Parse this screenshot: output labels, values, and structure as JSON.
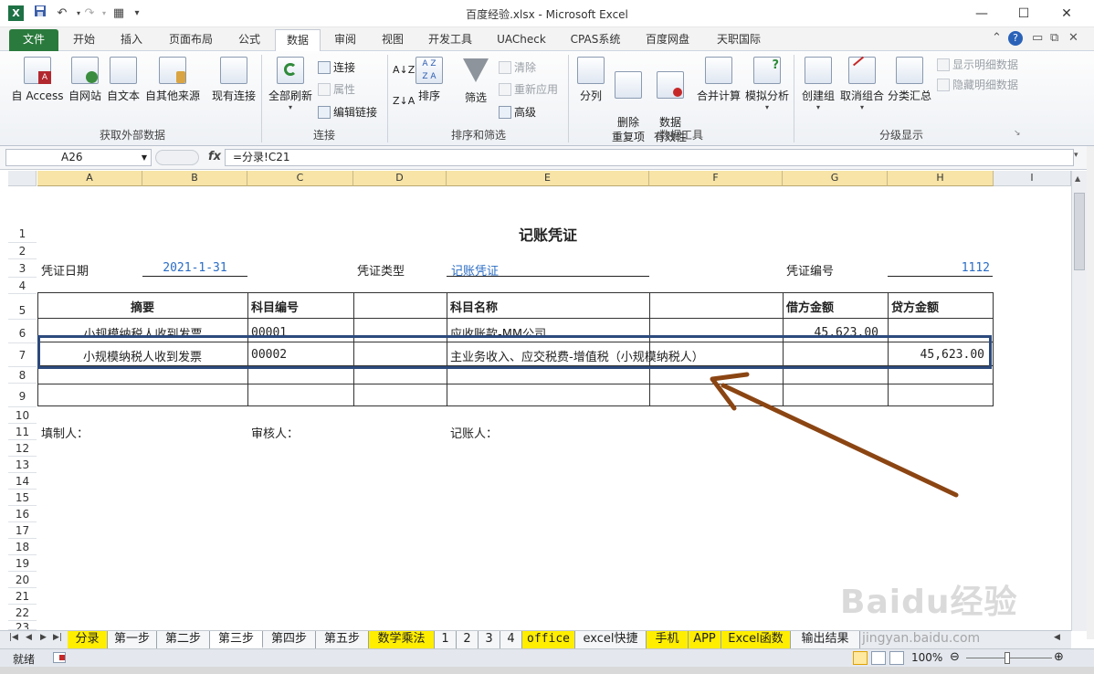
{
  "window": {
    "title": "百度经验.xlsx - Microsoft Excel",
    "minimize": "—",
    "maximize": "☐",
    "close": "✕"
  },
  "quick_access": {
    "logo": "X",
    "save_icon": "save-icon",
    "undo_icon": "undo-icon",
    "redo_icon": "redo-icon"
  },
  "ribbon_tabs": [
    "文件",
    "开始",
    "插入",
    "页面布局",
    "公式",
    "数据",
    "审阅",
    "视图",
    "开发工具",
    "UACheck",
    "CPAS系统",
    "百度网盘",
    "天职国际"
  ],
  "active_tab": "数据",
  "groups": {
    "external": {
      "label": "获取外部数据",
      "buttons": [
        "自 Access",
        "自网站",
        "自文本",
        "自其他来源",
        "现有连接"
      ]
    },
    "connections": {
      "label": "连接",
      "refresh": "全部刷新",
      "items": [
        "连接",
        "属性",
        "编辑链接"
      ]
    },
    "sort": {
      "label": "排序和筛选",
      "sort": "排序",
      "filter": "筛选",
      "items": [
        "清除",
        "重新应用",
        "高级"
      ]
    },
    "tools": {
      "label": "数据工具",
      "buttons": [
        "分列",
        "删除\n重复项",
        "数据\n有效性",
        "合并计算",
        "模拟分析"
      ]
    },
    "outline": {
      "label": "分级显示",
      "buttons": [
        "创建组",
        "取消组合",
        "分类汇总"
      ],
      "items": [
        "显示明细数据",
        "隐藏明细数据"
      ]
    }
  },
  "formula_bar": {
    "name_box": "A26",
    "fx": "fx",
    "formula": "=分录!C21"
  },
  "columns": [
    "A",
    "B",
    "C",
    "D",
    "E",
    "F",
    "G",
    "H",
    "I"
  ],
  "rows": [
    "1",
    "2",
    "3",
    "4",
    "5",
    "6",
    "7",
    "8",
    "9",
    "10",
    "11",
    "12",
    "13",
    "14",
    "15",
    "16",
    "17",
    "18",
    "19",
    "20",
    "21",
    "22",
    "23"
  ],
  "voucher": {
    "title": "记账凭证",
    "date_label": "凭证日期",
    "date_value": "2021-1-31",
    "type_label": "凭证类型",
    "type_value": "记账凭证",
    "number_label": "凭证编号",
    "number_value": "1112",
    "headers": {
      "summary": "摘要",
      "account_code": "科目编号",
      "account_name": "科目名称",
      "debit": "借方金额",
      "credit": "贷方金额"
    },
    "lines": [
      {
        "summary": "小规模纳税人收到发票",
        "code": "00001",
        "name": "应收账款-MM公司",
        "debit": "45,623.00",
        "credit": ""
      },
      {
        "summary": "小规模纳税人收到发票",
        "code": "00002",
        "name": "主业务收入、应交税费-增值税（小规模纳税人）",
        "debit": "",
        "credit": "45,623.00"
      }
    ],
    "preparer": "填制人：",
    "reviewer": "审核人：",
    "bookkeeper": "记账人："
  },
  "sheet_tabs": [
    "分录",
    "第一步",
    "第二步",
    "第三步",
    "第四步",
    "第五步",
    "数学乘法",
    "1",
    "2",
    "3",
    "4",
    "office",
    "excel快捷",
    "手机",
    "APP",
    "Excel函数",
    "输出结果"
  ],
  "active_sheet": "第三步",
  "status": {
    "ready": "就绪",
    "zoom": "100%"
  },
  "watermark": "Baidu经验",
  "watermark_url": "jingyan.baidu.com",
  "colors": {
    "excel_green": "#2b7a3d",
    "highlight_border": "#2c4a7c",
    "arrow": "#8b4513",
    "tab_yellow": "#ffee00",
    "header_yellow": "#f7e4a6"
  }
}
